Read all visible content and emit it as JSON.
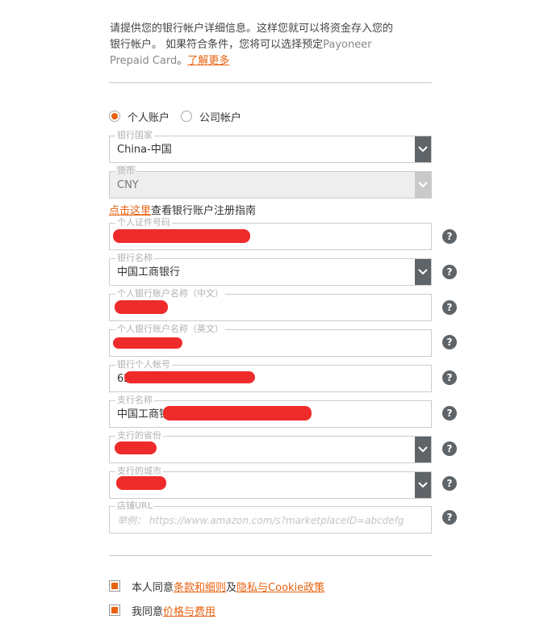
{
  "intro": {
    "line1": "请提供您的银行帐户详细信息。这样您就可以将资金存入您的",
    "line2": "银行帐户。 如果符合条件，您将可以选择预定",
    "line2_en": "Payoneer",
    "line3_en": "Prepaid Card",
    "line3_sep": "。",
    "learn_more": "了解更多"
  },
  "account_type": {
    "personal": "个人账户",
    "company": "公司帐户",
    "selected": "personal"
  },
  "fields": {
    "bank_country": {
      "label": "银行国家",
      "value": "China-中国"
    },
    "currency": {
      "label": "货币",
      "value": "CNY"
    },
    "id_number": {
      "label": "个人证件号码",
      "value": ""
    },
    "bank_name": {
      "label": "银行名称",
      "value": "中国工商银行"
    },
    "holder_name_cn": {
      "label": "个人银行账户名称（中文）",
      "value": ""
    },
    "holder_name_en": {
      "label": "个人银行账户名称（英文）",
      "value": ""
    },
    "account_number": {
      "label": "银行个人帐号",
      "value": "62"
    },
    "branch_name": {
      "label": "支行名称",
      "value": "中国工商银"
    },
    "branch_province": {
      "label": "支行的省份",
      "value": ""
    },
    "branch_city": {
      "label": "支行的城市",
      "value": ""
    },
    "store_url": {
      "label": "店铺URL",
      "placeholder": "举例： https://www.amazon.com/s?marketplaceID=abcdefg"
    }
  },
  "guide": {
    "link": "点击这里",
    "text": "查看银行账户注册指南"
  },
  "help_glyph": "?",
  "agreements": {
    "terms_prefix": "本人同意",
    "terms_link": "条款和细则",
    "terms_and": "及",
    "privacy_link": "隐私与Cookie政策",
    "fees_prefix": "我同意",
    "fees_link": "价格与费用",
    "terms_checked": true,
    "fees_checked": true
  },
  "colors": {
    "accent": "#e8610f",
    "redaction": "#ee2b2b",
    "dropdown": "#5f6468"
  }
}
